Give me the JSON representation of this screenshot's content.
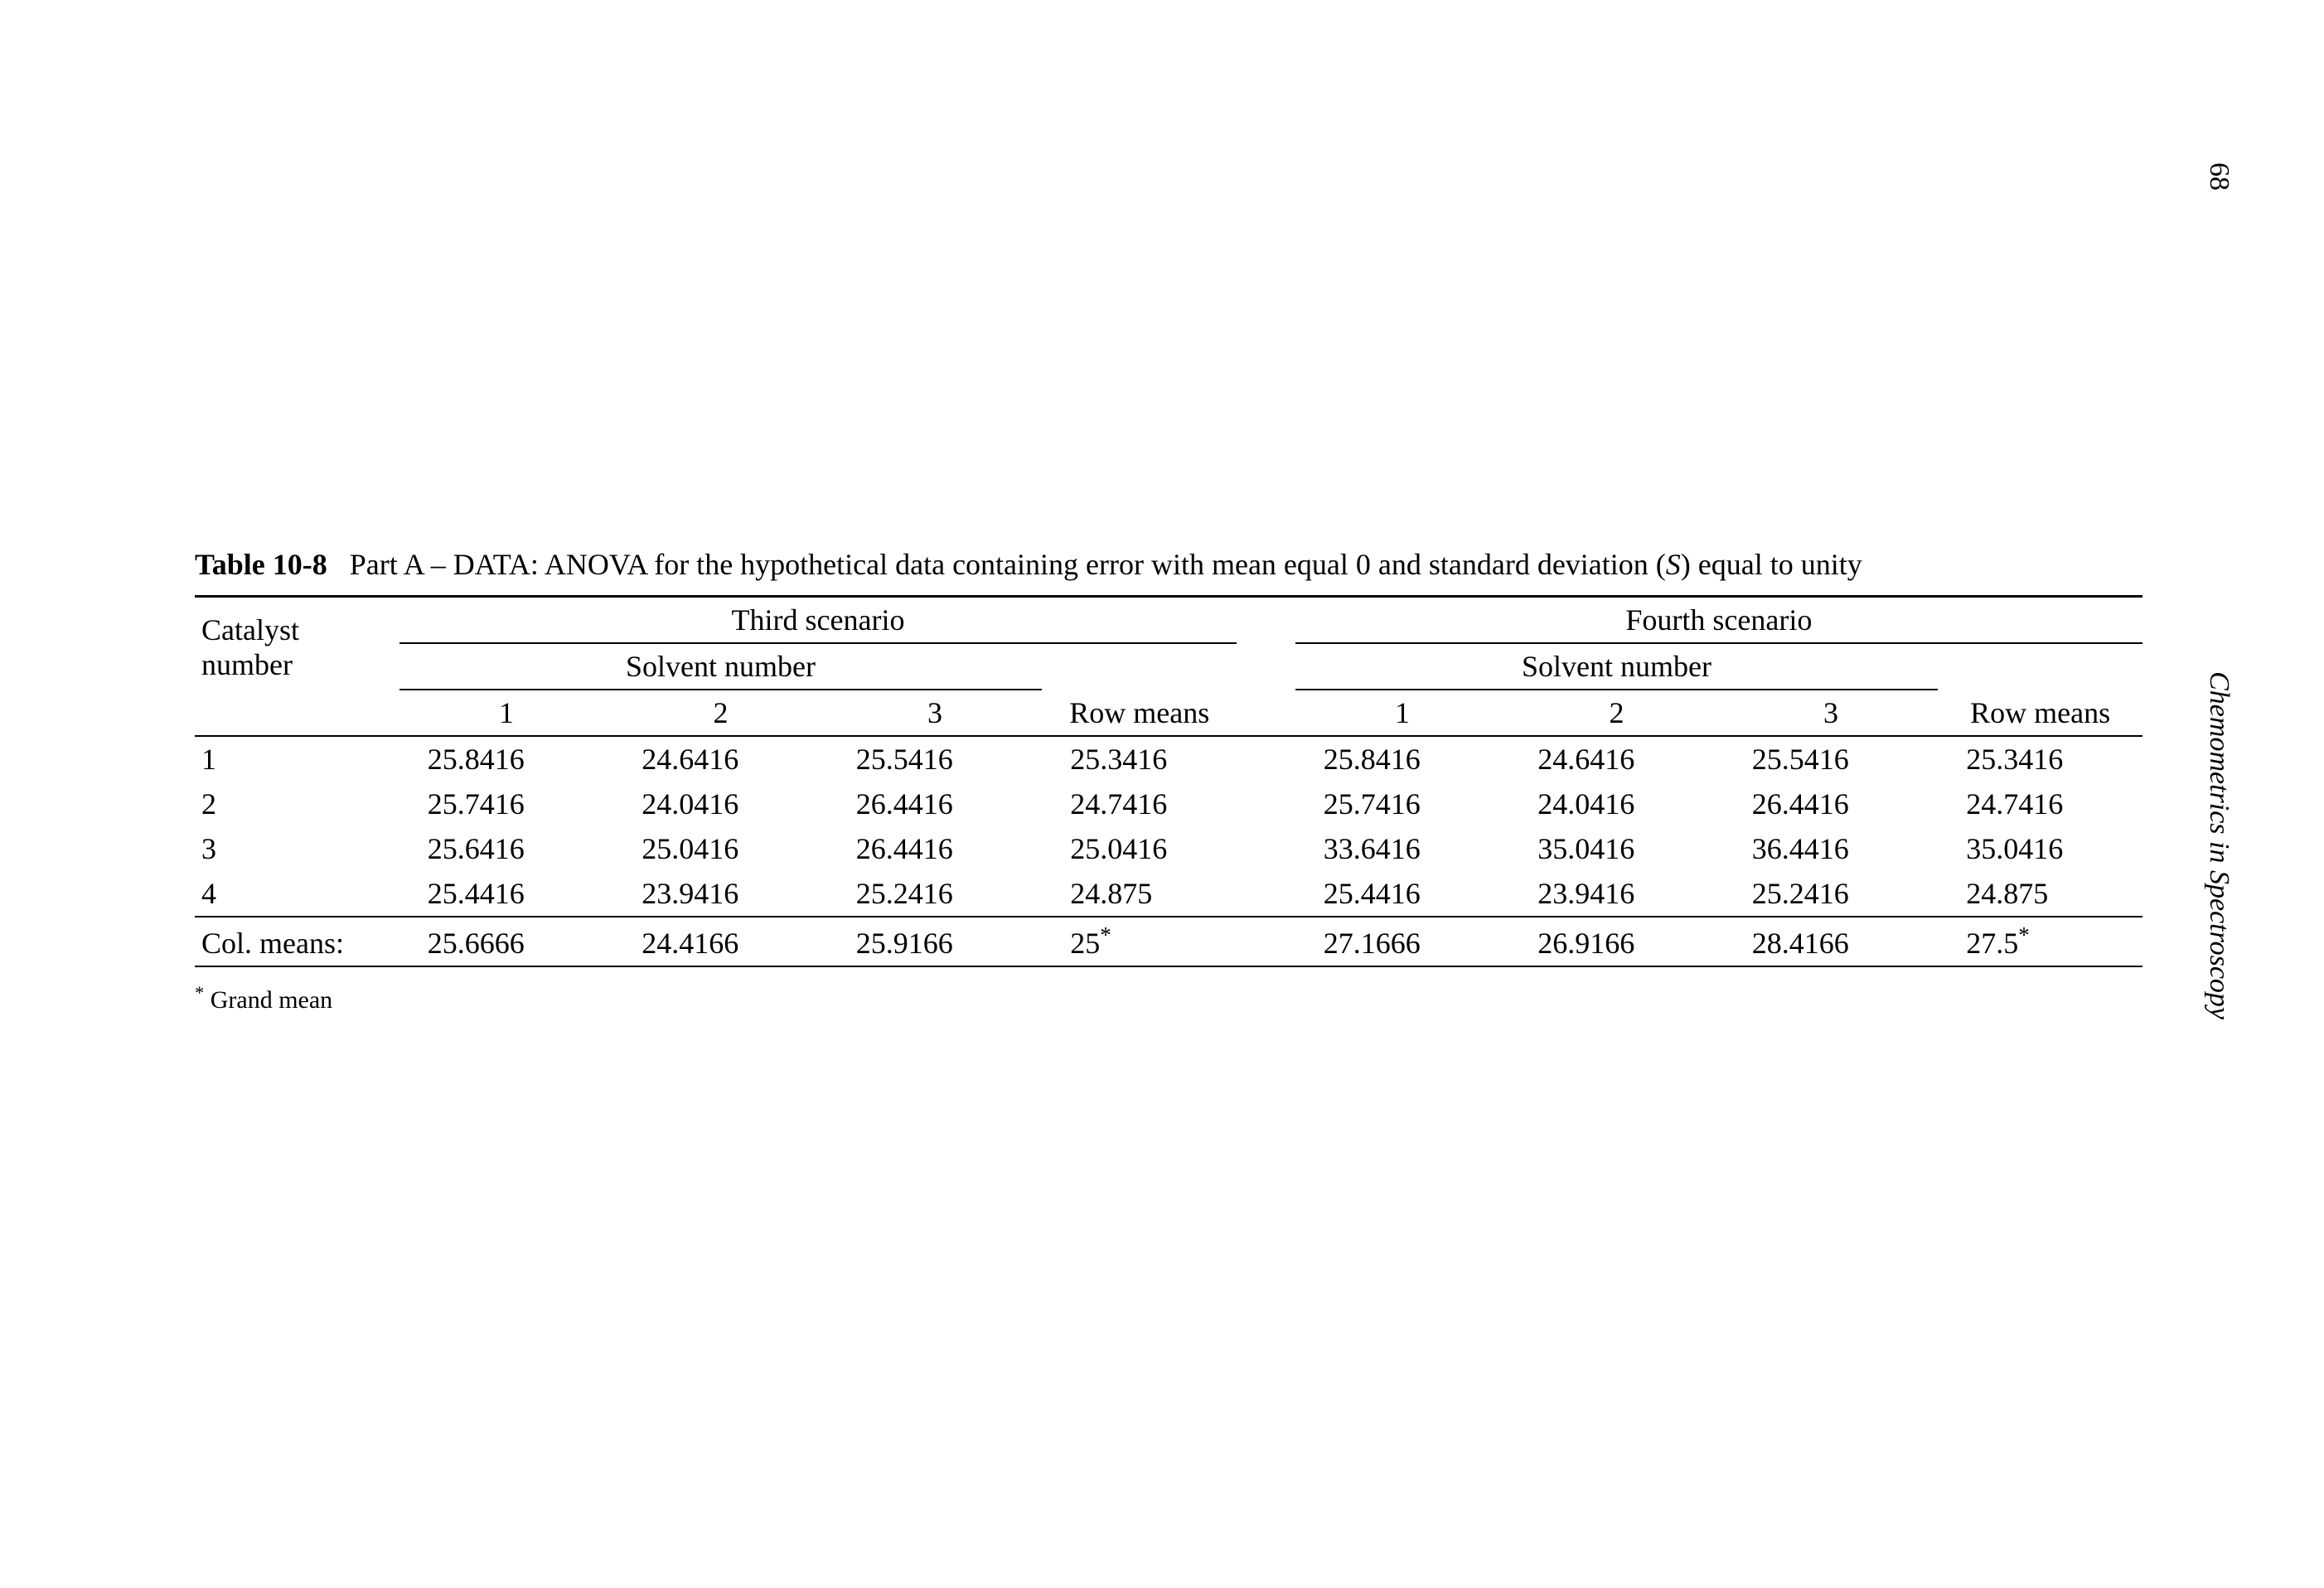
{
  "page_number": "68",
  "side_title": "Chemometrics in Spectroscopy",
  "caption": {
    "label": "Table 10-8",
    "text_before_S": "Part A – DATA: ANOVA for the hypothetical data containing error with mean equal 0 and standard deviation (",
    "S": "S",
    "text_after_S": ") equal to unity"
  },
  "headers": {
    "row_label": "Catalyst number",
    "scenario3": "Third scenario",
    "scenario4": "Fourth scenario",
    "solvent": "Solvent number",
    "row_means": "Row means",
    "col1": "1",
    "col2": "2",
    "col3": "3"
  },
  "rows": [
    {
      "label": "1",
      "s3": [
        "25.8416",
        "24.6416",
        "25.5416"
      ],
      "rm3": "25.3416",
      "s4": [
        "25.8416",
        "24.6416",
        "25.5416"
      ],
      "rm4": "25.3416"
    },
    {
      "label": "2",
      "s3": [
        "25.7416",
        "24.0416",
        "26.4416"
      ],
      "rm3": "24.7416",
      "s4": [
        "25.7416",
        "24.0416",
        "26.4416"
      ],
      "rm4": "24.7416"
    },
    {
      "label": "3",
      "s3": [
        "25.6416",
        "25.0416",
        "26.4416"
      ],
      "rm3": "25.0416",
      "s4": [
        "33.6416",
        "35.0416",
        "36.4416"
      ],
      "rm4": "35.0416"
    },
    {
      "label": "4",
      "s3": [
        "25.4416",
        "23.9416",
        "25.2416"
      ],
      "rm3": "24.875",
      "s4": [
        "25.4416",
        "23.9416",
        "25.2416"
      ],
      "rm4": "24.875"
    }
  ],
  "col_means": {
    "label": "Col. means:",
    "s3": [
      "25.6666",
      "24.4166",
      "25.9166"
    ],
    "grand3": "25",
    "s4": [
      "27.1666",
      "26.9166",
      "28.4166"
    ],
    "grand4": "27.5",
    "ast": "*"
  },
  "footnote": {
    "ast": "*",
    "text": "Grand mean"
  }
}
